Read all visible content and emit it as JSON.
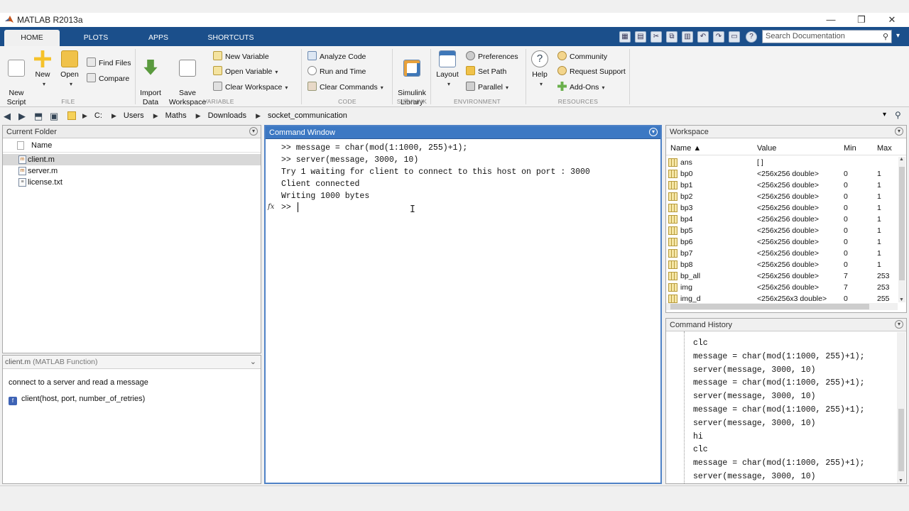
{
  "window": {
    "title": "MATLAB R2013a"
  },
  "tabs": [
    {
      "label": "HOME"
    },
    {
      "label": "PLOTS"
    },
    {
      "label": "APPS"
    },
    {
      "label": "SHORTCUTS"
    }
  ],
  "search": {
    "placeholder": "Search Documentation"
  },
  "ribbon": {
    "file": {
      "group": "FILE",
      "new_script": "New\nScript",
      "new": "New",
      "open": "Open",
      "find_files": "Find Files",
      "compare": "Compare"
    },
    "variable": {
      "group": "VARIABLE",
      "import_data": "Import\nData",
      "save_workspace": "Save\nWorkspace",
      "new_variable": "New Variable",
      "open_variable": "Open Variable",
      "clear_workspace": "Clear Workspace"
    },
    "code": {
      "group": "CODE",
      "analyze_code": "Analyze Code",
      "run_and_time": "Run and Time",
      "clear_commands": "Clear Commands"
    },
    "simulink": {
      "group": "SIMULINK",
      "simulink_library": "Simulink\nLibrary"
    },
    "environment": {
      "group": "ENVIRONMENT",
      "layout": "Layout",
      "preferences": "Preferences",
      "set_path": "Set Path",
      "parallel": "Parallel"
    },
    "resources": {
      "group": "RESOURCES",
      "help": "Help",
      "community": "Community",
      "request_support": "Request Support",
      "add_ons": "Add-Ons"
    }
  },
  "path": {
    "crumbs": [
      "C:",
      "Users",
      "Maths",
      "Downloads",
      "socket_communication"
    ]
  },
  "current_folder": {
    "title": "Current Folder",
    "column": "Name",
    "files": [
      {
        "name": "client.m",
        "selected": true
      },
      {
        "name": "server.m",
        "selected": false
      },
      {
        "name": "license.txt",
        "selected": false
      }
    ]
  },
  "details": {
    "file": "client.m",
    "kind": "(MATLAB Function)",
    "description": "connect to a server and read a message",
    "signature": "client(host, port, number_of_retries)"
  },
  "command_window": {
    "title": "Command Window",
    "lines": [
      ">> message = char(mod(1:1000, 255)+1);",
      ">> server(message, 3000, 10)",
      "Try 1 waiting for client to connect to this host on port : 3000",
      "Client connected",
      "Writing 1000 bytes"
    ],
    "prompt": ">>",
    "fx_label": "fx"
  },
  "workspace": {
    "title": "Workspace",
    "columns": {
      "name": "Name ▲",
      "value": "Value",
      "min": "Min",
      "max": "Max"
    },
    "rows": [
      {
        "name": "ans",
        "value": "[ ]",
        "min": "",
        "max": ""
      },
      {
        "name": "bp0",
        "value": "<256x256 double>",
        "min": "0",
        "max": "1"
      },
      {
        "name": "bp1",
        "value": "<256x256 double>",
        "min": "0",
        "max": "1"
      },
      {
        "name": "bp2",
        "value": "<256x256 double>",
        "min": "0",
        "max": "1"
      },
      {
        "name": "bp3",
        "value": "<256x256 double>",
        "min": "0",
        "max": "1"
      },
      {
        "name": "bp4",
        "value": "<256x256 double>",
        "min": "0",
        "max": "1"
      },
      {
        "name": "bp5",
        "value": "<256x256 double>",
        "min": "0",
        "max": "1"
      },
      {
        "name": "bp6",
        "value": "<256x256 double>",
        "min": "0",
        "max": "1"
      },
      {
        "name": "bp7",
        "value": "<256x256 double>",
        "min": "0",
        "max": "1"
      },
      {
        "name": "bp8",
        "value": "<256x256 double>",
        "min": "0",
        "max": "1"
      },
      {
        "name": "bp_all",
        "value": "<256x256 double>",
        "min": "7",
        "max": "253"
      },
      {
        "name": "img",
        "value": "<256x256 double>",
        "min": "7",
        "max": "253"
      },
      {
        "name": "img_d",
        "value": "<256x256x3 double>",
        "min": "0",
        "max": "255"
      }
    ]
  },
  "command_history": {
    "title": "Command History",
    "lines": [
      "clc",
      "message = char(mod(1:1000, 255)+1);",
      "server(message, 3000, 10)",
      "message = char(mod(1:1000, 255)+1);",
      "server(message, 3000, 10)",
      "message = char(mod(1:1000, 255)+1);",
      "server(message, 3000, 10)",
      "hi",
      "clc",
      "message = char(mod(1:1000, 255)+1);",
      "server(message, 3000, 10)"
    ]
  },
  "colors": {
    "tab_bar": "#1b4f8b",
    "active_panel_header": "#3c78c3"
  }
}
